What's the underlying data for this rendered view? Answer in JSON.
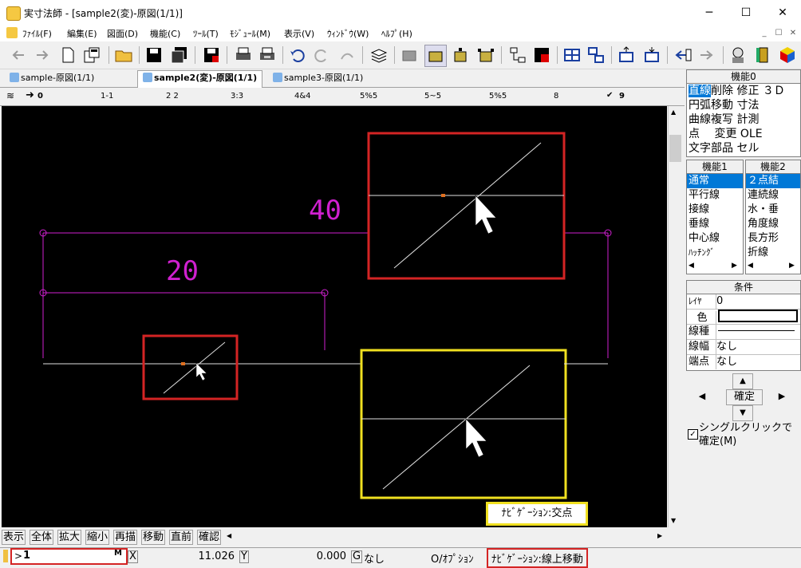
{
  "window": {
    "title": "実寸法師 - [sample2(変)-原図(1/1)]",
    "controls": {
      "minimize": "─",
      "maximize": "☐",
      "close": "✕"
    }
  },
  "menu": {
    "items": [
      "ﾌｧｲﾙ(F)",
      "編集(E)",
      "図面(D)",
      "機能(C)",
      "ﾂｰﾙ(T)",
      "ﾓｼﾞｭｰﾙ(M)",
      "表示(V)",
      "ｳｨﾝﾄﾞｳ(W)",
      "ﾍﾙﾌﾟ(H)"
    ],
    "mdi_controls": [
      "_",
      "☐",
      "✕"
    ]
  },
  "tabs": [
    {
      "label": "sample-原図(1/1)",
      "active": false
    },
    {
      "label": "sample2(変)-原図(1/1)",
      "active": true
    },
    {
      "label": "sample3-原図(1/1)",
      "active": false
    }
  ],
  "layers": {
    "current": "0",
    "items": [
      "1-1",
      "2 2",
      "3:3",
      "4&4",
      "5%5",
      "5~5",
      "5%5",
      "8"
    ],
    "last": "9"
  },
  "canvas": {
    "dimension_labels": [
      "40",
      "20"
    ],
    "navigation_label": "ﾅﾋﾞｹﾞｰｼｮﾝ:交点",
    "colors": {
      "background": "#000000",
      "dimension": "#d020d0",
      "line": "#e0e0e0",
      "highlight_red": "#d42424",
      "highlight_yellow": "#f0e020"
    }
  },
  "command_buttons": [
    "表示",
    "全体",
    "拡大",
    "縮小",
    "再描",
    "移動",
    "直前",
    "確認"
  ],
  "status": {
    "input_value": "1",
    "input_mark": "M",
    "x_label": "X",
    "x_value": "11.026",
    "y_label": "Y",
    "y_value": "0.000",
    "g_label": "G",
    "g_value": "なし",
    "option": "O/ｵﾌﾟｼｮﾝ",
    "navigation": "ﾅﾋﾞｹﾞｰｼｮﾝ:線上移動"
  },
  "panel": {
    "func0": {
      "title": "機能0",
      "items": [
        [
          "直線",
          "削除",
          "修正",
          "３Ｄ"
        ],
        [
          "円弧",
          "移動",
          "寸法",
          ""
        ],
        [
          "曲線",
          "複写",
          "計測",
          ""
        ],
        [
          "点",
          "変更",
          "OLE",
          ""
        ],
        [
          "文字",
          "部品",
          "セル",
          ""
        ]
      ],
      "selected": "直線"
    },
    "func1": {
      "title": "機能1",
      "items": [
        "通常",
        "平行線",
        "接線",
        "垂線",
        "中心線",
        "ﾊｯﾁﾝｸﾞ"
      ],
      "selected": "通常"
    },
    "func2": {
      "title": "機能2",
      "items": [
        "２点結",
        "連続線",
        "水・垂",
        "角度線",
        "長方形",
        "折線"
      ],
      "selected": "２点結"
    },
    "conditions": {
      "title": "条件",
      "rows": [
        {
          "label": "ﾚｲﾔ",
          "value": "0"
        },
        {
          "label": "色",
          "value": ""
        },
        {
          "label": "線種",
          "value": ""
        },
        {
          "label": "線幅",
          "value": "なし"
        },
        {
          "label": "端点",
          "value": "なし"
        }
      ]
    },
    "confirm_label": "確定",
    "single_click_label": "シングルクリックで確定(M)",
    "single_click_checked": true
  }
}
